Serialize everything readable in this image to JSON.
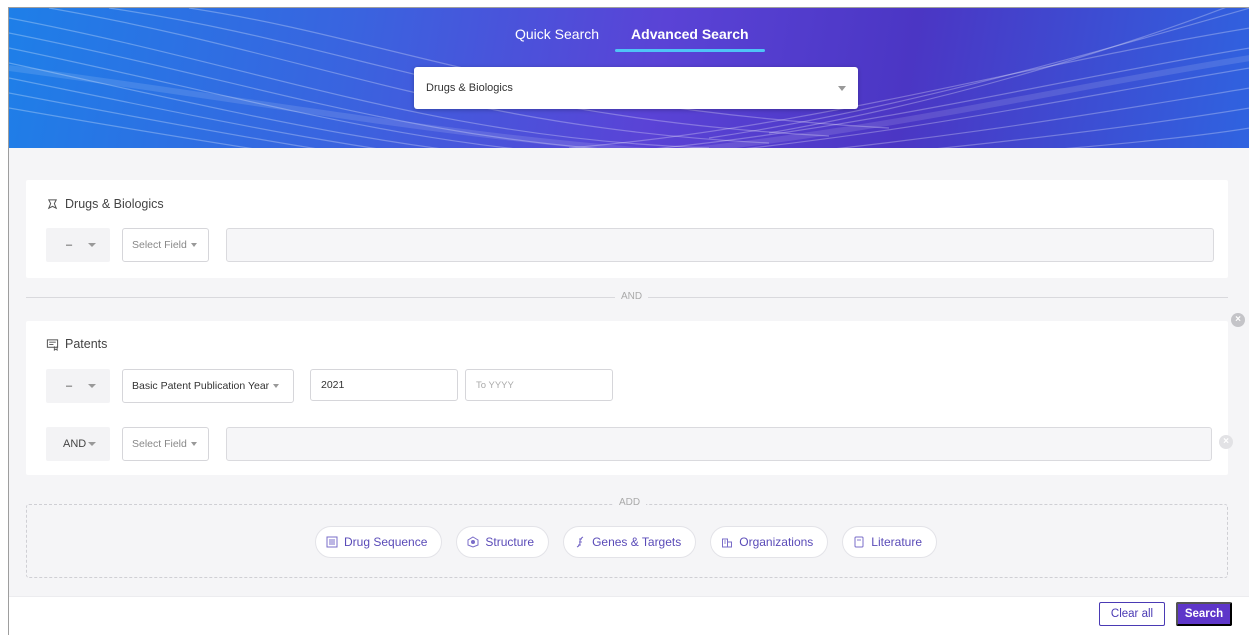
{
  "colors": {
    "accent": "#5e36c9",
    "tab_underline": "#4fc3f7",
    "link": "#5a4bb8"
  },
  "header": {
    "tabs": [
      {
        "label": "Quick Search",
        "active": false
      },
      {
        "label": "Advanced Search",
        "active": true
      }
    ],
    "domain_select": {
      "value": "Drugs & Biologics"
    }
  },
  "drugs_card": {
    "title": "Drugs & Biologics",
    "icon": "drug-icon",
    "rows": [
      {
        "operator": "–",
        "field": "Select Field",
        "value": ""
      }
    ]
  },
  "connector_1": "AND",
  "patents_card": {
    "title": "Patents",
    "icon": "patent-icon",
    "rows": [
      {
        "operator": "–",
        "field": "Basic Patent Publication Year",
        "from_value": "2021",
        "to_placeholder": "To YYYY"
      },
      {
        "operator": "AND",
        "field": "Select Field",
        "value": ""
      }
    ]
  },
  "add_section": {
    "label": "ADD",
    "buttons": [
      {
        "label": "Drug Sequence",
        "icon": "sequence-icon"
      },
      {
        "label": "Structure",
        "icon": "structure-icon"
      },
      {
        "label": "Genes & Targets",
        "icon": "gene-icon"
      },
      {
        "label": "Organizations",
        "icon": "organization-icon"
      },
      {
        "label": "Literature",
        "icon": "literature-icon"
      }
    ]
  },
  "footer": {
    "clear_label": "Clear all",
    "search_label": "Search"
  }
}
